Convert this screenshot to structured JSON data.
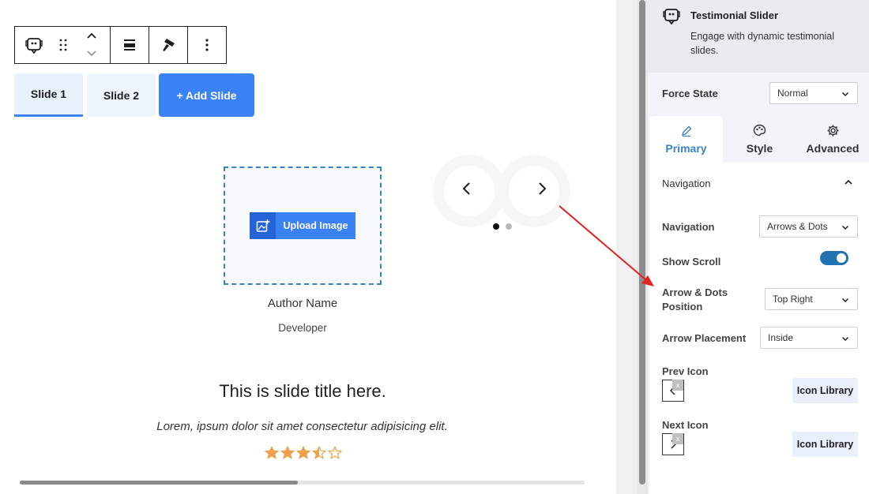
{
  "block_toolbar": {
    "icons": [
      "testimonial-block-icon",
      "drag-handle-icon",
      "move-up-icon",
      "move-down-icon",
      "align-icon",
      "brush-icon",
      "more-options-icon"
    ]
  },
  "slide_tabs": {
    "slide1": "Slide 1",
    "slide2": "Slide 2",
    "add": "+ Add Slide"
  },
  "slide": {
    "upload_label": "Upload Image",
    "author_name": "Author Name",
    "author_role": "Developer",
    "title": "This is slide title here.",
    "text": "Lorem, ipsum dolor sit amet consectetur adipisicing elit.",
    "rating": 3.5,
    "rating_max": 5,
    "star_color": "#f0a04b"
  },
  "slider_nav": {
    "dots": 2,
    "active_dot": 1
  },
  "panel": {
    "block_title": "Testimonial Slider",
    "block_desc": "Engage with dynamic testimonial slides.",
    "force_state_label": "Force State",
    "force_state_value": "Normal",
    "tabs": {
      "primary": "Primary",
      "style": "Style",
      "advanced": "Advanced"
    },
    "section_title": "Navigation",
    "navigation_label": "Navigation",
    "navigation_value": "Arrows & Dots",
    "show_scroll_label": "Show Scroll",
    "show_scroll_on": true,
    "position_label_line1": "Arrow & Dots",
    "position_label_line2": "Position",
    "position_value": "Top Right",
    "placement_label": "Arrow Placement",
    "placement_value": "Inside",
    "prev_icon_label": "Prev Icon",
    "next_icon_label": "Next Icon",
    "icon_library_label": "Icon Library",
    "clear_mark": "x"
  },
  "colors": {
    "accent": "#3b82f6",
    "toggle": "#2271b1",
    "annotation_arrow": "#e02424"
  }
}
